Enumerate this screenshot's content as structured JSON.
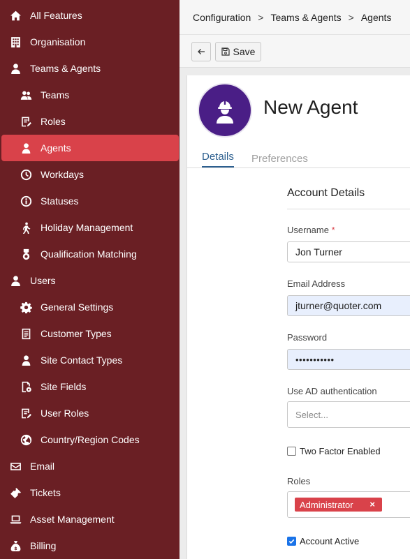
{
  "sidebar": {
    "items": [
      {
        "label": "All Features",
        "icon": "home-icon"
      },
      {
        "label": "Organisation",
        "icon": "building-icon"
      },
      {
        "label": "Teams & Agents",
        "icon": "person-icon"
      },
      {
        "label": "Teams",
        "icon": "people-icon"
      },
      {
        "label": "Roles",
        "icon": "roles-icon"
      },
      {
        "label": "Agents",
        "icon": "person-icon"
      },
      {
        "label": "Workdays",
        "icon": "clock-icon"
      },
      {
        "label": "Statuses",
        "icon": "info-icon"
      },
      {
        "label": "Holiday Management",
        "icon": "walking-icon"
      },
      {
        "label": "Qualification Matching",
        "icon": "medal-icon"
      },
      {
        "label": "Users",
        "icon": "person-icon"
      },
      {
        "label": "General Settings",
        "icon": "gear-icon"
      },
      {
        "label": "Customer Types",
        "icon": "document-icon"
      },
      {
        "label": "Site Contact Types",
        "icon": "person-icon"
      },
      {
        "label": "Site Fields",
        "icon": "page-gear-icon"
      },
      {
        "label": "User Roles",
        "icon": "roles-icon"
      },
      {
        "label": "Country/Region Codes",
        "icon": "globe-icon"
      },
      {
        "label": "Email",
        "icon": "envelope-icon"
      },
      {
        "label": "Tickets",
        "icon": "ticket-icon"
      },
      {
        "label": "Asset Management",
        "icon": "laptop-icon"
      },
      {
        "label": "Billing",
        "icon": "money-bag-icon"
      }
    ],
    "active_color": "#d9424a",
    "background": "#6a1f24"
  },
  "breadcrumb": {
    "items": [
      "Configuration",
      "Teams & Agents",
      "Agents"
    ],
    "separator": ">"
  },
  "toolbar": {
    "back_icon": "arrow-left-icon",
    "save_label": "Save",
    "save_icon": "floppy-disk-icon"
  },
  "header": {
    "title": "New Agent",
    "avatar_icon": "hardhat-worker-icon",
    "avatar_color": "#4a1e86"
  },
  "tabs": [
    {
      "label": "Details",
      "active": true
    },
    {
      "label": "Preferences",
      "active": false
    }
  ],
  "form": {
    "section_title": "Account Details",
    "username": {
      "label": "Username",
      "required_mark": "*",
      "value": "Jon Turner"
    },
    "email": {
      "label": "Email Address",
      "value": "jturner@quoter.com"
    },
    "password": {
      "label": "Password",
      "value": "•••••••••••"
    },
    "ad_auth": {
      "label": "Use AD authentication",
      "placeholder": "Select..."
    },
    "two_factor": {
      "label": "Two Factor Enabled",
      "checked": false
    },
    "roles": {
      "label": "Roles",
      "tags": [
        "Administrator"
      ],
      "remove_symbol": "×"
    },
    "account_active": {
      "label": "Account Active",
      "checked": true
    }
  }
}
